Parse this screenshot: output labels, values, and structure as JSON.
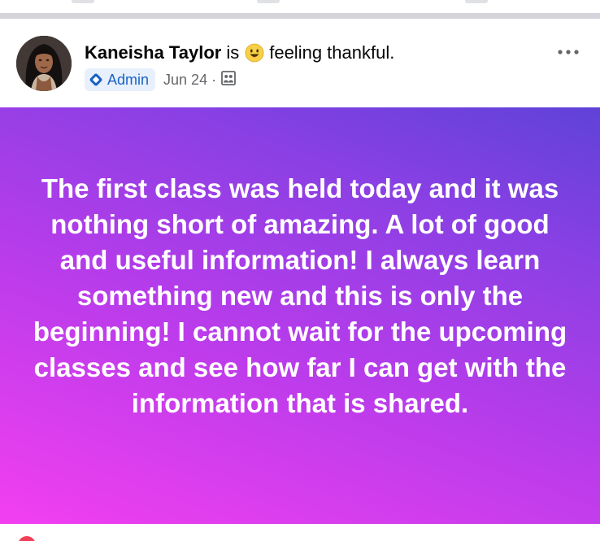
{
  "post": {
    "author": "Kaneisha Taylor",
    "verb": "is",
    "feeling": "feeling thankful.",
    "feeling_icon": "smiling-emoji-icon",
    "badge": "Admin",
    "badge_icon": "admin-diamond-icon",
    "date": "Jun 24",
    "separator": "·",
    "audience_icon": "group-audience-icon",
    "more_icon": "more-options-icon",
    "text": "The first class was held today and it was nothing short of amazing. A lot of good and useful information! I always learn something new and this is only the beginning! I cannot wait for the upcoming classes and see how far I can get with the information that is shared.",
    "background_colors": [
      "#f23ff0",
      "#b63cea",
      "#8a40e4",
      "#5f42d8"
    ]
  },
  "colors": {
    "name": "#050505",
    "meta": "#65676b",
    "badge_bg": "#e7f0fc",
    "badge_text": "#1b62c4",
    "divider": "#d3d5da"
  }
}
